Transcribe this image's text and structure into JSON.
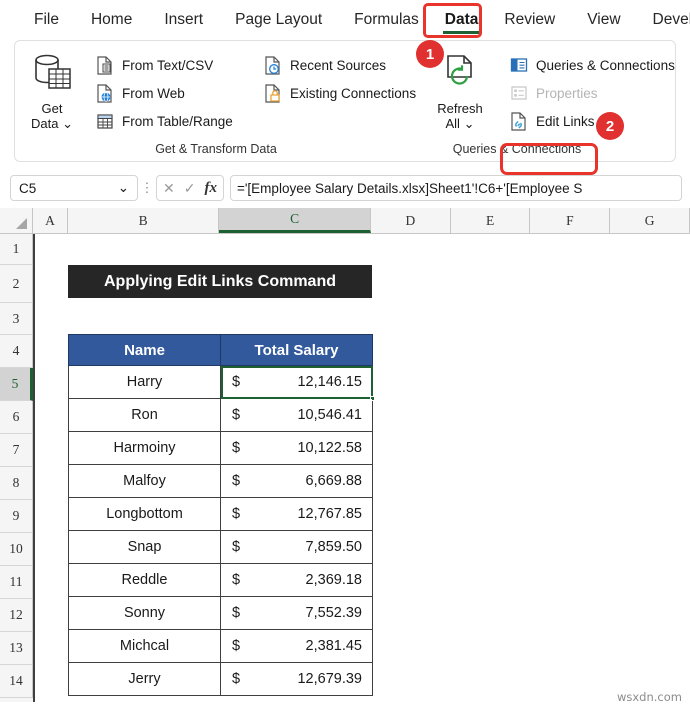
{
  "ribbon": {
    "tabs": [
      {
        "label": "File",
        "active": false
      },
      {
        "label": "Home",
        "active": false
      },
      {
        "label": "Insert",
        "active": false
      },
      {
        "label": "Page Layout",
        "active": false
      },
      {
        "label": "Formulas",
        "active": false
      },
      {
        "label": "Data",
        "active": true
      },
      {
        "label": "Review",
        "active": false
      },
      {
        "label": "View",
        "active": false
      },
      {
        "label": "Developer",
        "active": false
      }
    ],
    "groups": [
      {
        "label": "Get & Transform Data",
        "big_button": {
          "line1": "Get",
          "line2": "Data",
          "icon": "get-data-icon",
          "dropdown": "⌄"
        },
        "items_col1": [
          {
            "label": "From Text/CSV",
            "icon": "text-csv-icon",
            "disabled": false
          },
          {
            "label": "From Web",
            "icon": "web-icon",
            "disabled": false
          },
          {
            "label": "From Table/Range",
            "icon": "table-range-icon",
            "disabled": false
          }
        ],
        "items_col2": [
          {
            "label": "Recent Sources",
            "icon": "recent-sources-icon",
            "disabled": false
          },
          {
            "label": "Existing Connections",
            "icon": "existing-connections-icon",
            "disabled": false
          }
        ]
      },
      {
        "label": "Queries & Connections",
        "big_button": {
          "line1": "Refresh",
          "line2": "All",
          "icon": "refresh-all-icon",
          "dropdown": "⌄"
        },
        "items_col1": [
          {
            "label": "Queries & Connections",
            "icon": "queries-connections-icon",
            "disabled": false
          },
          {
            "label": "Properties",
            "icon": "properties-icon",
            "disabled": true
          },
          {
            "label": "Edit Links",
            "icon": "edit-links-icon",
            "disabled": false
          }
        ]
      }
    ],
    "callouts": [
      {
        "number": "1",
        "color": "#e03030"
      },
      {
        "number": "2",
        "color": "#e03030"
      }
    ],
    "highlight_color": "#e8342a",
    "active_tab_underline_color": "#1d6132"
  },
  "formula_bar": {
    "name_box_value": "C5",
    "name_box_chevron": "⌄",
    "more_icon": "⋮",
    "cancel_icon": "✕",
    "enter_icon": "✓",
    "fx_icon": "fx",
    "formula": "='[Employee Salary Details.xlsx]Sheet1'!C6+'[Employee S"
  },
  "grid": {
    "columns": [
      "A",
      "B",
      "C",
      "D",
      "E",
      "F",
      "G"
    ],
    "selected_column": "C",
    "rows": [
      "1",
      "2",
      "3",
      "4",
      "5",
      "6",
      "7",
      "8",
      "9",
      "10",
      "11",
      "12",
      "13",
      "14"
    ],
    "selected_row": "5",
    "selected_cell": "C5",
    "selection_color": "#1d6132"
  },
  "sheet": {
    "title_banner": "Applying Edit Links Command",
    "banner_bg": "#262626",
    "table": {
      "header_bg": "#31599c",
      "headers": [
        "Name",
        "Total Salary"
      ],
      "currency_symbol": "$",
      "rows": [
        {
          "name": "Harry",
          "salary": "12,146.15"
        },
        {
          "name": "Ron",
          "salary": "10,546.41"
        },
        {
          "name": "Harmoiny",
          "salary": "10,122.58"
        },
        {
          "name": "Malfoy",
          "salary": "6,669.88"
        },
        {
          "name": "Longbottom",
          "salary": "12,767.85"
        },
        {
          "name": "Snap",
          "salary": "7,859.50"
        },
        {
          "name": "Reddle",
          "salary": "2,369.18"
        },
        {
          "name": "Sonny",
          "salary": "7,552.39"
        },
        {
          "name": "Michcal",
          "salary": "2,381.45"
        },
        {
          "name": "Jerry",
          "salary": "12,679.39"
        }
      ]
    }
  },
  "watermark": "wsxdn.com"
}
